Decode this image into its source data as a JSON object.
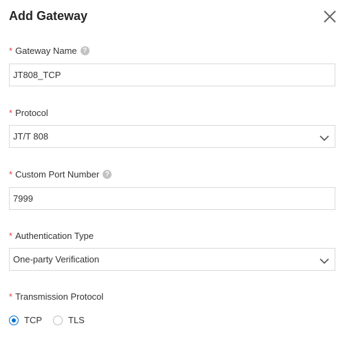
{
  "dialog": {
    "title": "Add Gateway",
    "close_icon": "close-icon"
  },
  "fields": {
    "gateway_name": {
      "label": "Gateway Name",
      "required_mark": "*",
      "value": "JT808_TCP"
    },
    "protocol": {
      "label": "Protocol",
      "required_mark": "*",
      "value": "JT/T 808"
    },
    "custom_port": {
      "label": "Custom Port Number",
      "required_mark": "*",
      "value": "7999"
    },
    "auth_type": {
      "label": "Authentication Type",
      "required_mark": "*",
      "value": "One-party Verification"
    },
    "transmission": {
      "label": "Transmission Protocol",
      "required_mark": "*",
      "options": [
        "TCP",
        "TLS"
      ],
      "selected": "TCP"
    }
  },
  "icons": {
    "help": "help-icon",
    "chevron": "chevron-down-icon"
  },
  "colors": {
    "accent": "#0070cc",
    "required": "#e5403b",
    "border": "#d9d9d9"
  }
}
